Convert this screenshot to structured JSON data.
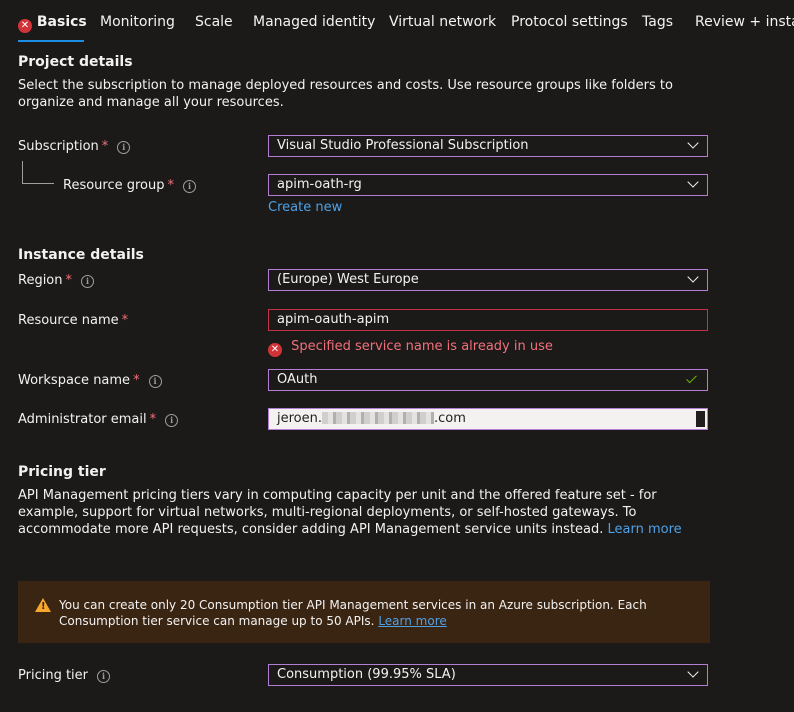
{
  "tabs": [
    {
      "label": "Basics",
      "active": true,
      "has_error": true
    },
    {
      "label": "Monitoring"
    },
    {
      "label": "Scale"
    },
    {
      "label": "Managed identity"
    },
    {
      "label": "Virtual network"
    },
    {
      "label": "Protocol settings"
    },
    {
      "label": "Tags"
    },
    {
      "label": "Review + install"
    }
  ],
  "project": {
    "heading": "Project details",
    "description": "Select the subscription to manage deployed resources and costs. Use resource groups like folders to organize and manage all your resources.",
    "subscription_label": "Subscription",
    "subscription_value": "Visual Studio Professional Subscription",
    "resource_group_label": "Resource group",
    "resource_group_value": "apim-oath-rg",
    "create_new": "Create new"
  },
  "instance": {
    "heading": "Instance details",
    "region_label": "Region",
    "region_value": "(Europe) West Europe",
    "resource_name_label": "Resource name",
    "resource_name_value": "apim-oauth-apim",
    "resource_name_error": "Specified service name is already in use",
    "workspace_label": "Workspace name",
    "workspace_value": "OAuth",
    "admin_email_label": "Administrator email",
    "admin_email_prefix": "jeroen.",
    "admin_email_suffix": ".com"
  },
  "pricing": {
    "heading": "Pricing tier",
    "description": "API Management pricing tiers vary in computing capacity per unit and the offered feature set - for example, support for virtual networks, multi-regional deployments, or self-hosted gateways. To accommodate more API requests, consider adding API Management service units instead.",
    "learn_more": "Learn more",
    "warning_text": "You can create only 20 Consumption tier API Management services in an Azure subscription. Each Consumption tier service can manage up to 50 APIs.",
    "warning_learn_more": "Learn more",
    "tier_label": "Pricing tier",
    "tier_value": "Consumption (99.95% SLA)"
  },
  "required_mark": "*",
  "icons": {
    "error": "error-circle-icon",
    "info": "info-icon",
    "warning": "warning-triangle-icon",
    "chevron": "chevron-down-icon",
    "check": "checkmark-icon"
  },
  "colors": {
    "background": "#1b1a19",
    "accent": "#1b8de3",
    "field_border": "#b37fd6",
    "error": "#f1707b",
    "link": "#4ea1e6",
    "warning_bg": "#3a2513",
    "success": "#6bb700"
  }
}
